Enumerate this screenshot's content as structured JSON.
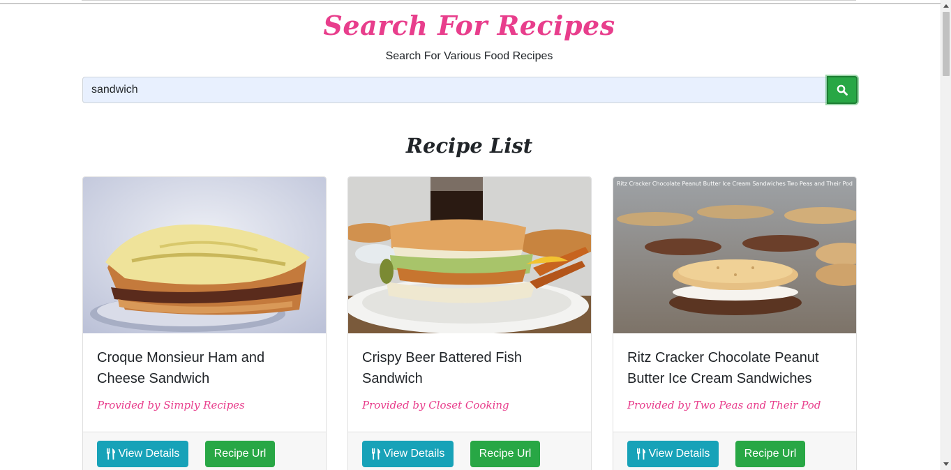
{
  "header": {
    "title": "Search For Recipes",
    "subtitle": "Search For Various Food Recipes"
  },
  "search": {
    "value": "sandwich",
    "icon": "search-icon"
  },
  "section": {
    "title": "Recipe List"
  },
  "colors": {
    "accent_pink": "#e83e8c",
    "info": "#17a2b8",
    "success": "#28a745"
  },
  "recipes": [
    {
      "title": "Croque Monsieur Ham and Cheese Sandwich",
      "provider": "Provided by Simply Recipes",
      "details_label": "View Details",
      "url_label": "Recipe Url"
    },
    {
      "title": "Crispy Beer Battered Fish Sandwich",
      "provider": "Provided by Closet Cooking",
      "details_label": "View Details",
      "url_label": "Recipe Url"
    },
    {
      "title": "Ritz Cracker Chocolate Peanut Butter Ice Cream Sandwiches",
      "provider": "Provided by Two Peas and Their Pod",
      "details_label": "View Details",
      "url_label": "Recipe Url",
      "image_overlay_text": "Ritz Cracker Chocolate Peanut Butter Ice Cream Sandwiches Two Peas and Their Pod"
    }
  ]
}
